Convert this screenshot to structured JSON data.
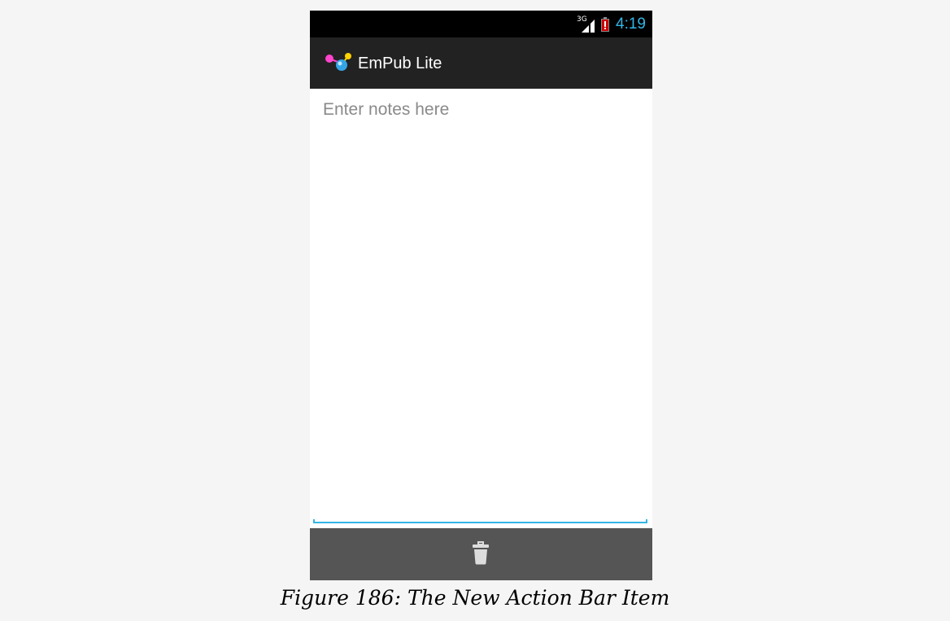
{
  "status_bar": {
    "network": "3G",
    "time": "4:19",
    "icons": [
      "signal-icon",
      "battery-low-icon"
    ]
  },
  "action_bar": {
    "app_icon": "empub-logo-icon",
    "title": "EmPub Lite"
  },
  "editor": {
    "value": "",
    "placeholder": "Enter notes here"
  },
  "bottom_bar": {
    "actions": [
      {
        "icon": "trash-icon",
        "action": "delete"
      }
    ]
  },
  "caption": "Figure 186: The New Action Bar Item",
  "colors": {
    "accent": "#33b5e5",
    "action_bar_bg": "#222222",
    "bottom_bar_bg": "#555555",
    "battery_warning": "#cc0000",
    "page_bg": "#f5f5f5"
  }
}
